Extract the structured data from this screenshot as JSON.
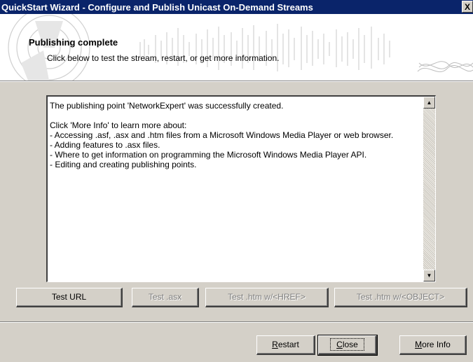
{
  "window": {
    "title": "QuickStart Wizard - Configure and Publish Unicast On-Demand Streams",
    "close_label": "X"
  },
  "header": {
    "title": "Publishing complete",
    "subtitle": "Click below to test the stream, restart, or get more information."
  },
  "info": {
    "line1": "The publishing point 'NetworkExpert' was successfully created.",
    "line2": "Click 'More Info' to learn more about:",
    "items": [
      "- Accessing .asf, .asx and .htm files from a Microsoft Windows Media Player or web browser.",
      "- Adding features to .asx files.",
      "- Where to get information on programming the Microsoft Windows Media Player API.",
      "- Editing and creating publishing points."
    ]
  },
  "tests": {
    "url": "Test URL",
    "asx": "Test .asx",
    "href": "Test .htm w/<HREF>",
    "object": "Test .htm w/<OBJECT>"
  },
  "footer": {
    "restart_first": "R",
    "restart_rest": "estart",
    "close_first": "C",
    "close_rest": "lose",
    "more_first": "M",
    "more_rest": "ore Info"
  },
  "icons": {
    "scroll_up": "▲",
    "scroll_down": "▼"
  }
}
